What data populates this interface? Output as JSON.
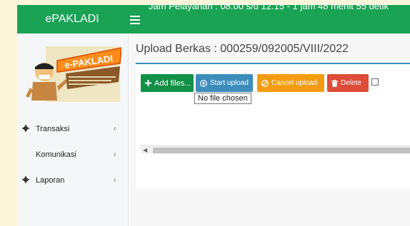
{
  "header": {
    "brand": "ePAKLADI",
    "marquee": "Jam Pelayanan : 08.00 s/d 12.15 - 1 jam 48 menit 55 detik",
    "bg_color": "#1aa355"
  },
  "sidebar": {
    "logo_text": "e-PAKLADI",
    "items": [
      {
        "label": "Transaksi",
        "icon": "gear-icon",
        "chevron": "‹"
      },
      {
        "label": "Komunikasi",
        "icon": "",
        "chevron": "‹"
      },
      {
        "label": "Laporan",
        "icon": "gear-icon",
        "chevron": "‹"
      }
    ]
  },
  "main": {
    "title": "Upload Berkas : 000259/092005/VIII/2022",
    "buttons": {
      "add": "Add files...",
      "start": "Start upload",
      "cancel": "Cancel upload",
      "delete": "Delete"
    },
    "tooltip": "No file chosen"
  },
  "colors": {
    "add": "#139048",
    "start": "#3c8dbc",
    "cancel": "#f39c12",
    "delete": "#dd4b39"
  }
}
